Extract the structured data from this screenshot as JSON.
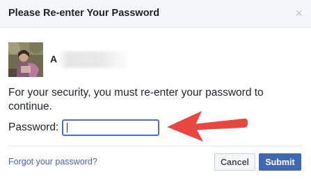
{
  "dialog": {
    "title": "Please Re-enter Your Password",
    "close_symbol": "×"
  },
  "user": {
    "name": "A",
    "avatar_icon": "profile-photo"
  },
  "message": "For your security, you must re-enter your password to continue.",
  "password": {
    "label": "Password:",
    "value": "",
    "placeholder": ""
  },
  "annotation": {
    "arrow_icon": "red-arrow-pointing-left",
    "color": "#e8473f"
  },
  "footer": {
    "forgot_label": "Forgot your password?",
    "cancel_label": "Cancel",
    "submit_label": "Submit"
  },
  "colors": {
    "accent": "#4267b2",
    "focus_border": "#4a6fd0",
    "header_bg": "#f5f6f7"
  }
}
